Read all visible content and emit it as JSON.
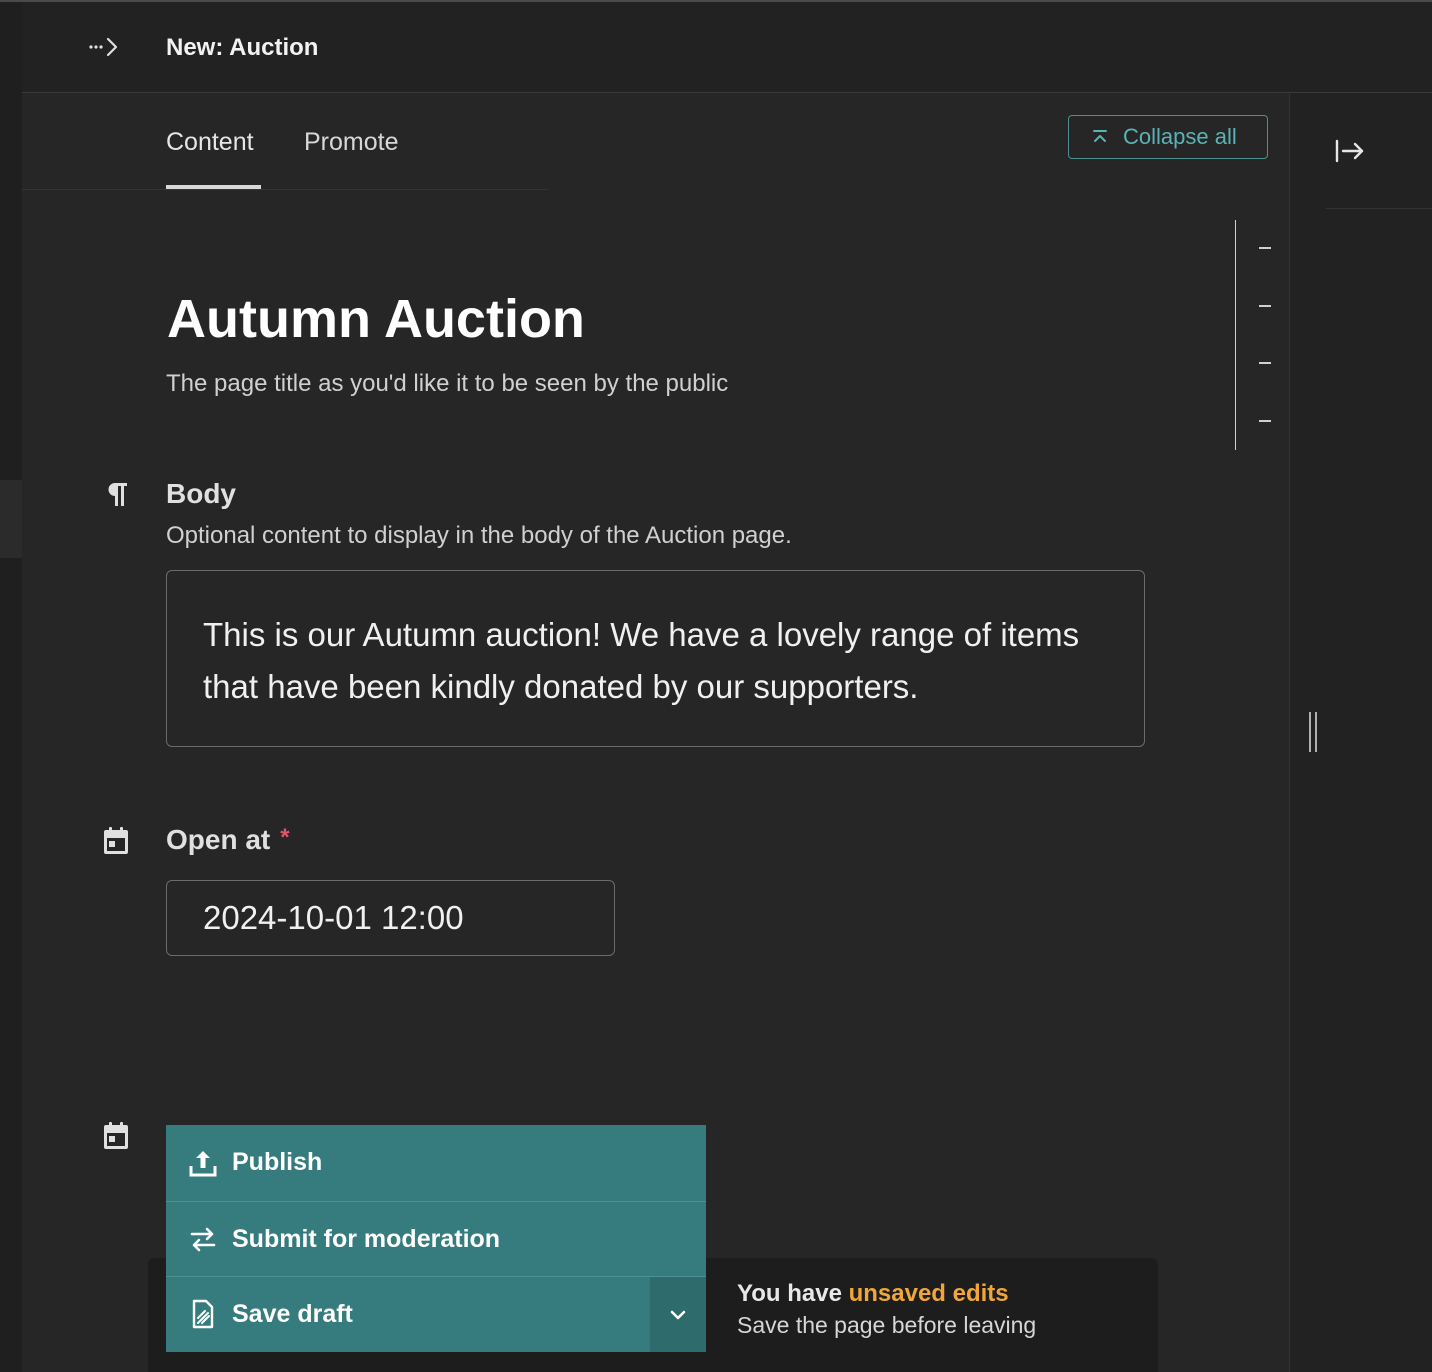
{
  "header": {
    "title": "New: Auction",
    "breadcrumb_icon": "dots-chevron-right-icon"
  },
  "tabs": [
    {
      "label": "Content",
      "active": true
    },
    {
      "label": "Promote",
      "active": false
    }
  ],
  "toolbar": {
    "collapse_all_label": "Collapse all",
    "collapse_icon": "collapse-up-icon"
  },
  "side_panel": {
    "toggle_icon": "arrow-right-to-line-icon"
  },
  "page": {
    "title": "Autumn Auction",
    "title_help": "The page title as you'd like it to be seen by the public"
  },
  "fields": {
    "body": {
      "label": "Body",
      "help": "Optional content to display in the body of the Auction page.",
      "value": "This is our Autumn auction! We have a lovely range of items that have been kindly donated by our supporters.",
      "icon": "pilcrow-icon"
    },
    "open_at": {
      "label": "Open at",
      "required_mark": "*",
      "value": "2024-10-01 12:00",
      "icon": "calendar-icon"
    },
    "second_date": {
      "icon": "calendar-icon"
    }
  },
  "actions": {
    "publish": "Publish",
    "submit": "Submit for moderation",
    "save_draft": "Save draft"
  },
  "status": {
    "prefix": "You have ",
    "highlight": "unsaved edits",
    "subtitle": "Save the page before leaving",
    "highlight_color": "#f0a63a"
  },
  "colors": {
    "accent": "#367c7e",
    "link": "#5ab3b6",
    "required": "#e0556b"
  }
}
